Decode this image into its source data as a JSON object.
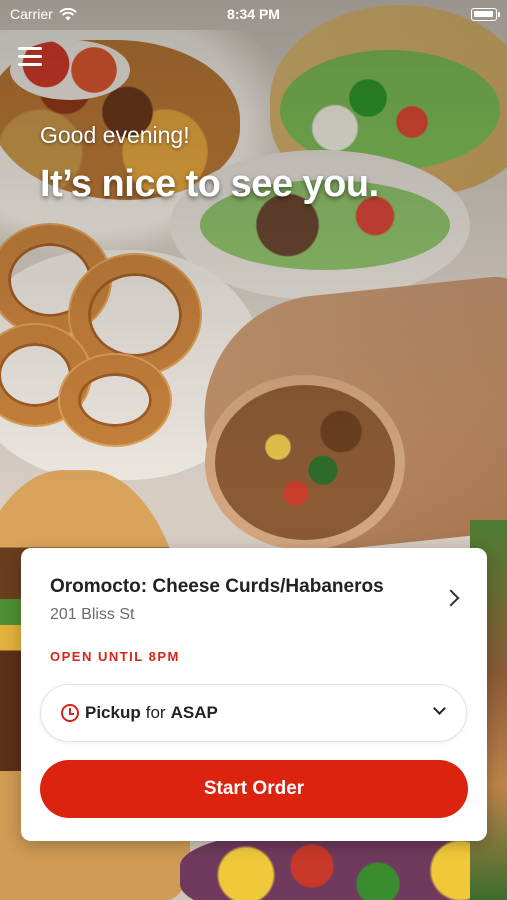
{
  "status_bar": {
    "carrier": "Carrier",
    "time": "8:34 PM"
  },
  "header": {
    "greeting": "Good evening!",
    "headline": "It’s nice to see you."
  },
  "store_card": {
    "store_name": "Oromocto: Cheese Curds/Habaneros",
    "address": "201 Bliss St",
    "open_status": "OPEN UNTIL 8PM",
    "order_mode": "Pickup",
    "order_mode_connector": "for",
    "order_time": "ASAP",
    "start_order_label": "Start Order"
  },
  "colors": {
    "accent": "#db230f",
    "status_red": "#d62418",
    "card_bg": "#ffffff",
    "text_primary": "#222222",
    "text_secondary": "#6b6b6b"
  },
  "icons": {
    "menu": "hamburger-menu-icon",
    "wifi": "wifi-icon",
    "battery": "battery-icon",
    "store_chevron": "chevron-right-icon",
    "clock": "clock-icon",
    "pickup_dropdown": "chevron-down-icon"
  }
}
